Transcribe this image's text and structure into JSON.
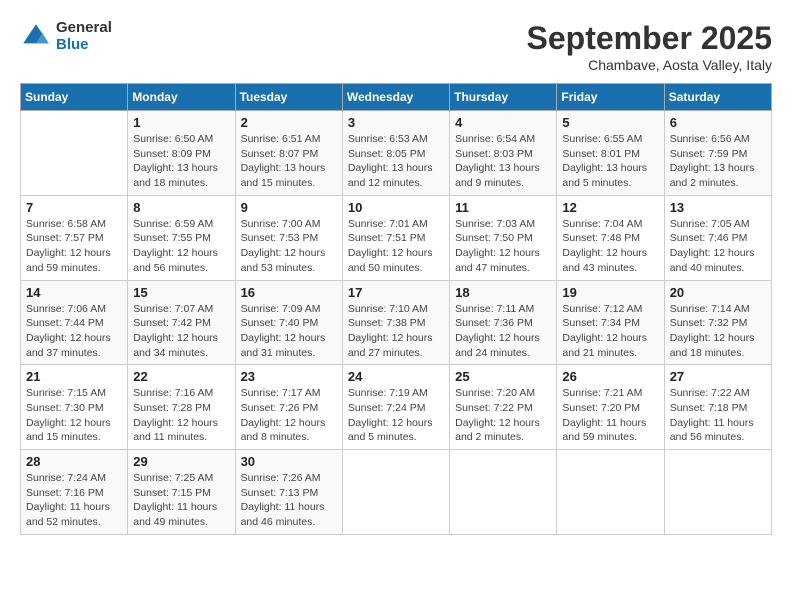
{
  "logo": {
    "general": "General",
    "blue": "Blue"
  },
  "header": {
    "month": "September 2025",
    "location": "Chambave, Aosta Valley, Italy"
  },
  "days_of_week": [
    "Sunday",
    "Monday",
    "Tuesday",
    "Wednesday",
    "Thursday",
    "Friday",
    "Saturday"
  ],
  "weeks": [
    [
      {
        "day": "",
        "info": ""
      },
      {
        "day": "1",
        "info": "Sunrise: 6:50 AM\nSunset: 8:09 PM\nDaylight: 13 hours\nand 18 minutes."
      },
      {
        "day": "2",
        "info": "Sunrise: 6:51 AM\nSunset: 8:07 PM\nDaylight: 13 hours\nand 15 minutes."
      },
      {
        "day": "3",
        "info": "Sunrise: 6:53 AM\nSunset: 8:05 PM\nDaylight: 13 hours\nand 12 minutes."
      },
      {
        "day": "4",
        "info": "Sunrise: 6:54 AM\nSunset: 8:03 PM\nDaylight: 13 hours\nand 9 minutes."
      },
      {
        "day": "5",
        "info": "Sunrise: 6:55 AM\nSunset: 8:01 PM\nDaylight: 13 hours\nand 5 minutes."
      },
      {
        "day": "6",
        "info": "Sunrise: 6:56 AM\nSunset: 7:59 PM\nDaylight: 13 hours\nand 2 minutes."
      }
    ],
    [
      {
        "day": "7",
        "info": "Sunrise: 6:58 AM\nSunset: 7:57 PM\nDaylight: 12 hours\nand 59 minutes."
      },
      {
        "day": "8",
        "info": "Sunrise: 6:59 AM\nSunset: 7:55 PM\nDaylight: 12 hours\nand 56 minutes."
      },
      {
        "day": "9",
        "info": "Sunrise: 7:00 AM\nSunset: 7:53 PM\nDaylight: 12 hours\nand 53 minutes."
      },
      {
        "day": "10",
        "info": "Sunrise: 7:01 AM\nSunset: 7:51 PM\nDaylight: 12 hours\nand 50 minutes."
      },
      {
        "day": "11",
        "info": "Sunrise: 7:03 AM\nSunset: 7:50 PM\nDaylight: 12 hours\nand 47 minutes."
      },
      {
        "day": "12",
        "info": "Sunrise: 7:04 AM\nSunset: 7:48 PM\nDaylight: 12 hours\nand 43 minutes."
      },
      {
        "day": "13",
        "info": "Sunrise: 7:05 AM\nSunset: 7:46 PM\nDaylight: 12 hours\nand 40 minutes."
      }
    ],
    [
      {
        "day": "14",
        "info": "Sunrise: 7:06 AM\nSunset: 7:44 PM\nDaylight: 12 hours\nand 37 minutes."
      },
      {
        "day": "15",
        "info": "Sunrise: 7:07 AM\nSunset: 7:42 PM\nDaylight: 12 hours\nand 34 minutes."
      },
      {
        "day": "16",
        "info": "Sunrise: 7:09 AM\nSunset: 7:40 PM\nDaylight: 12 hours\nand 31 minutes."
      },
      {
        "day": "17",
        "info": "Sunrise: 7:10 AM\nSunset: 7:38 PM\nDaylight: 12 hours\nand 27 minutes."
      },
      {
        "day": "18",
        "info": "Sunrise: 7:11 AM\nSunset: 7:36 PM\nDaylight: 12 hours\nand 24 minutes."
      },
      {
        "day": "19",
        "info": "Sunrise: 7:12 AM\nSunset: 7:34 PM\nDaylight: 12 hours\nand 21 minutes."
      },
      {
        "day": "20",
        "info": "Sunrise: 7:14 AM\nSunset: 7:32 PM\nDaylight: 12 hours\nand 18 minutes."
      }
    ],
    [
      {
        "day": "21",
        "info": "Sunrise: 7:15 AM\nSunset: 7:30 PM\nDaylight: 12 hours\nand 15 minutes."
      },
      {
        "day": "22",
        "info": "Sunrise: 7:16 AM\nSunset: 7:28 PM\nDaylight: 12 hours\nand 11 minutes."
      },
      {
        "day": "23",
        "info": "Sunrise: 7:17 AM\nSunset: 7:26 PM\nDaylight: 12 hours\nand 8 minutes."
      },
      {
        "day": "24",
        "info": "Sunrise: 7:19 AM\nSunset: 7:24 PM\nDaylight: 12 hours\nand 5 minutes."
      },
      {
        "day": "25",
        "info": "Sunrise: 7:20 AM\nSunset: 7:22 PM\nDaylight: 12 hours\nand 2 minutes."
      },
      {
        "day": "26",
        "info": "Sunrise: 7:21 AM\nSunset: 7:20 PM\nDaylight: 11 hours\nand 59 minutes."
      },
      {
        "day": "27",
        "info": "Sunrise: 7:22 AM\nSunset: 7:18 PM\nDaylight: 11 hours\nand 56 minutes."
      }
    ],
    [
      {
        "day": "28",
        "info": "Sunrise: 7:24 AM\nSunset: 7:16 PM\nDaylight: 11 hours\nand 52 minutes."
      },
      {
        "day": "29",
        "info": "Sunrise: 7:25 AM\nSunset: 7:15 PM\nDaylight: 11 hours\nand 49 minutes."
      },
      {
        "day": "30",
        "info": "Sunrise: 7:26 AM\nSunset: 7:13 PM\nDaylight: 11 hours\nand 46 minutes."
      },
      {
        "day": "",
        "info": ""
      },
      {
        "day": "",
        "info": ""
      },
      {
        "day": "",
        "info": ""
      },
      {
        "day": "",
        "info": ""
      }
    ]
  ]
}
